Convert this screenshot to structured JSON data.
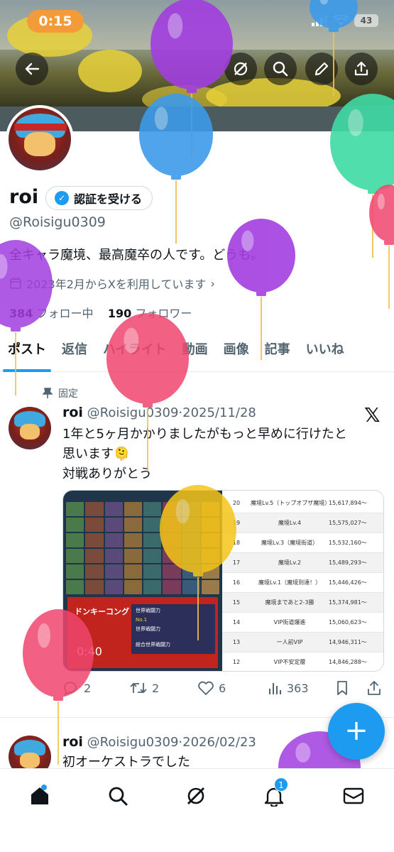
{
  "status": {
    "time": "0:15",
    "battery": "43"
  },
  "profile": {
    "name": "roi",
    "verify_label": "認証を受ける",
    "handle": "@Roisigu0309",
    "bio": "全キャラ魔境、最高魔卒の人です。どうも。",
    "joined": "2023年2月からXを利用しています",
    "following_count": "384",
    "following_label": "フォロー中",
    "followers_count": "190",
    "followers_label": "フォロワー"
  },
  "tabs": [
    "ポスト",
    "返信",
    "ハイライト",
    "動画",
    "画像",
    "記事",
    "いいね"
  ],
  "pinned_label": "固定",
  "posts": [
    {
      "name": "roi",
      "handle": "@Roisigu0309",
      "date": "·2025/11/28",
      "lines": [
        "1年と5ヶ月かかりましたがもっと早めに行けたと",
        "思います🫠",
        "対戦ありがとう"
      ],
      "video_time": "0:40",
      "media_text": {
        "dk": "ドンキーコング",
        "power1": "世界戦闘力",
        "no1": "No.1",
        "power2": "世界戦闘力",
        "all": "総合世界戦闘力"
      },
      "table": [
        {
          "rank": "20",
          "label": "魔境Lv.5（トップオブザ魔境）",
          "value": "15,617,894〜"
        },
        {
          "rank": "19",
          "label": "魔境Lv.4",
          "value": "15,575,027〜"
        },
        {
          "rank": "18",
          "label": "魔境Lv.3（魔境街道）",
          "value": "15,532,160〜"
        },
        {
          "rank": "17",
          "label": "魔境Lv.2",
          "value": "15,489,293〜"
        },
        {
          "rank": "16",
          "label": "魔境Lv.1（魔境到達！）",
          "value": "15,446,426〜"
        },
        {
          "rank": "15",
          "label": "魔境まであと2-3勝",
          "value": "15,374,981〜"
        },
        {
          "rank": "14",
          "label": "VIP街道爆進",
          "value": "15,060,623〜"
        },
        {
          "rank": "13",
          "label": "一人前VIP",
          "value": "14,946,311〜"
        },
        {
          "rank": "12",
          "label": "VIP不安定層",
          "value": "14,846,288〜"
        }
      ],
      "replies": "2",
      "reposts": "2",
      "likes": "6",
      "views": "363"
    },
    {
      "name": "roi",
      "handle": "@Roisigu0309",
      "date": "·2026/02/23",
      "lines": [
        "初オーケストラでした"
      ]
    }
  ],
  "notifications_badge": "1",
  "colors": {
    "accent": "#1d9bf0",
    "status_pill": "#f39a3b"
  },
  "icons": [
    "back-arrow-icon",
    "grok-icon",
    "search-icon",
    "edit-icon",
    "share-icon",
    "calendar-icon",
    "pin-icon",
    "x-logo-icon",
    "reply-icon",
    "repost-icon",
    "like-icon",
    "views-icon",
    "bookmark-icon",
    "home-icon",
    "notifications-icon",
    "messages-icon"
  ]
}
